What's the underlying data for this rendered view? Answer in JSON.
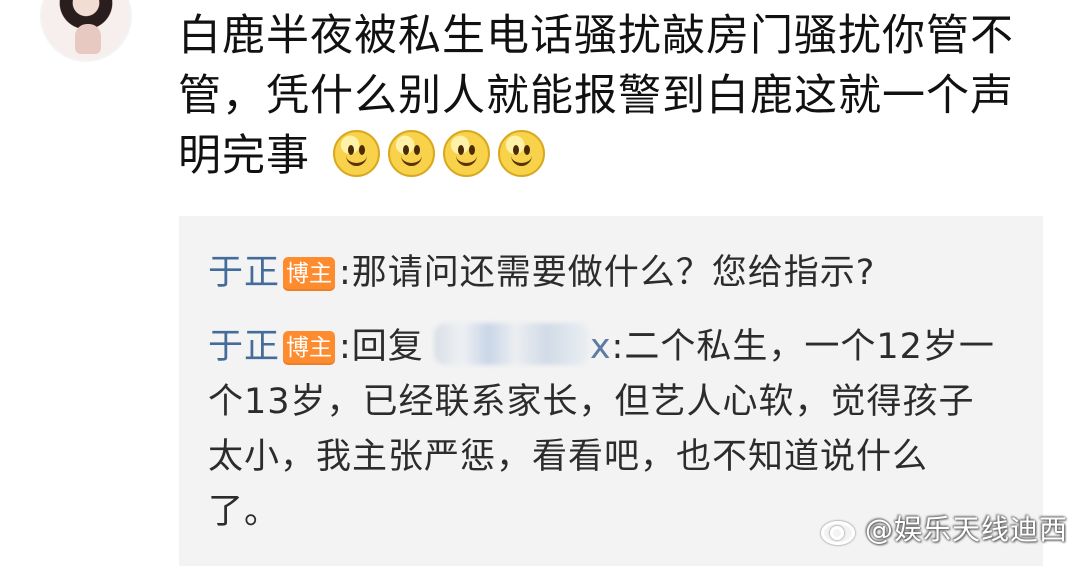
{
  "comment": {
    "avatar_icon": "user-avatar",
    "text": "白鹿半夜被私生电话骚扰敲房门骚扰你管不管，凭什么别人就能报警到白鹿这就一个声明完事",
    "emoji_name": "smiley-icon",
    "emoji_count": 4
  },
  "replies": [
    {
      "username": "于正",
      "badge": "博主",
      "text": ":那请问还需要做什么？您给指示?"
    },
    {
      "username": "于正",
      "badge": "博主",
      "prefix": ":回复",
      "reply_suffix": "x",
      "text": ":二个私生，一个12岁一个13岁，已经联系家长，但艺人心软，觉得孩子太小，我主张严惩，看看吧，也不知道说什么了。"
    }
  ],
  "watermark": {
    "icon": "weibo-icon",
    "text": "@娱乐天线迪西"
  },
  "colors": {
    "username": "#446c9b",
    "badge": "#ff8b2f",
    "quote_background": "#f3f3f3"
  }
}
